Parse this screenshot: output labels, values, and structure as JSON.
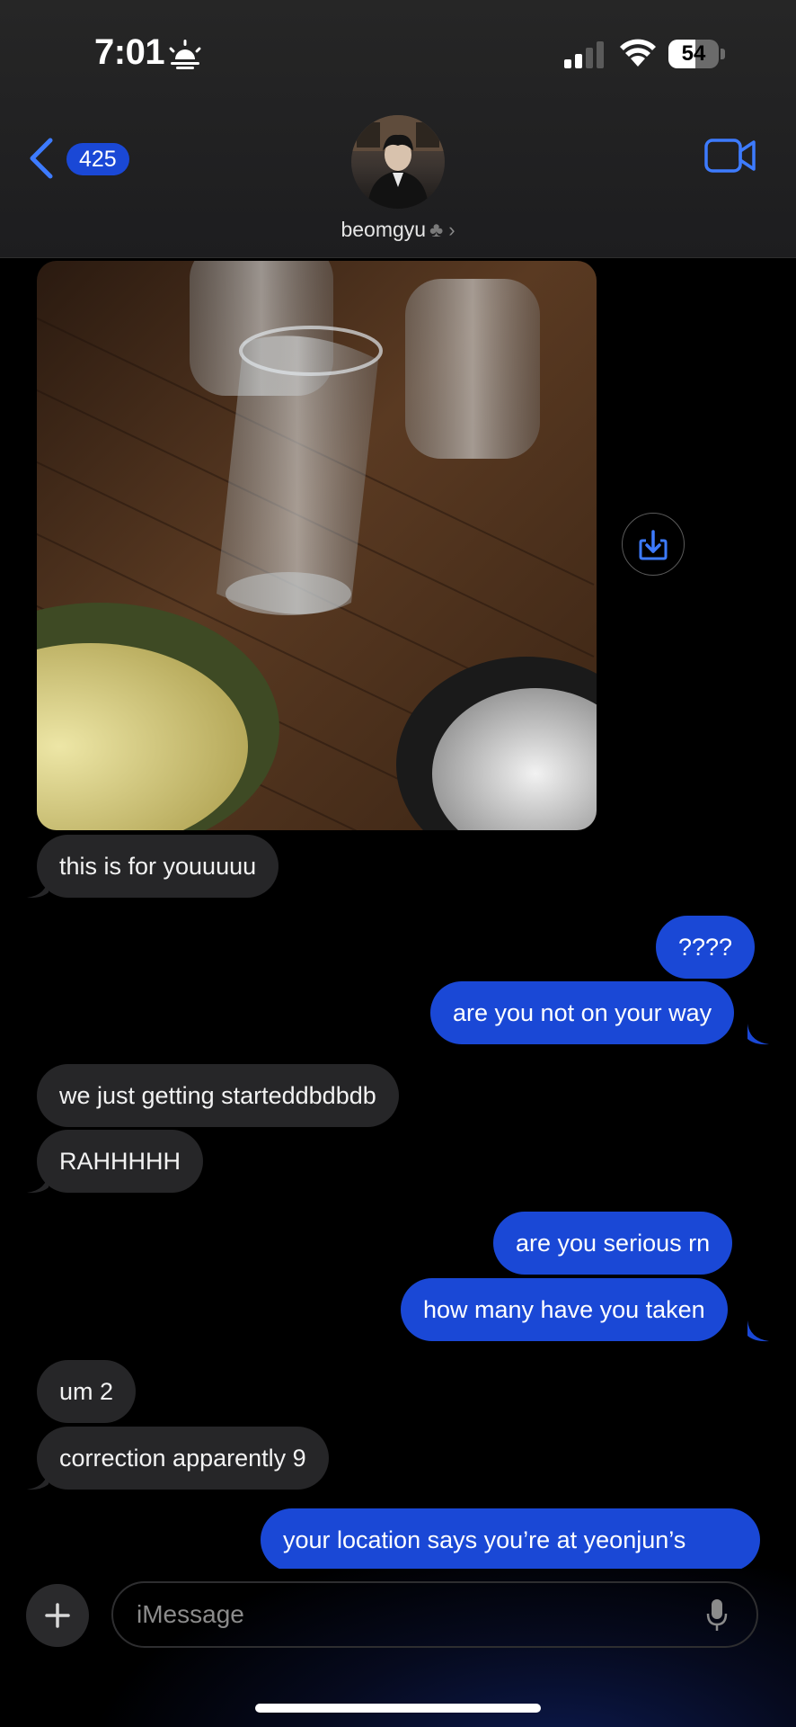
{
  "status_bar": {
    "time": "7:01",
    "time_icon": "sunrise-icon",
    "battery_percent": 54,
    "battery_label": "54"
  },
  "header": {
    "back_badge": "425",
    "contact_name": "beomgyu",
    "contact_emoji": "♣",
    "accent": "#1a48d6"
  },
  "messages": [
    {
      "side": "received",
      "type": "photo",
      "description_icon": "photo-attachment"
    },
    {
      "side": "received",
      "text": "this is for youuuuu"
    },
    {
      "side": "sent",
      "text": "????"
    },
    {
      "side": "sent",
      "text": "are you not on your way"
    },
    {
      "side": "received",
      "text": "we just getting starteddbdbdb"
    },
    {
      "side": "received",
      "text": "RAHHHHH"
    },
    {
      "side": "sent",
      "text": "are you serious rn"
    },
    {
      "side": "sent",
      "text": "how many have you taken"
    },
    {
      "side": "received",
      "text": "um 2"
    },
    {
      "side": "received",
      "text": "correction apparently 9"
    },
    {
      "side": "sent",
      "text": "your location says you’re at yeonjun’s"
    }
  ],
  "compose": {
    "placeholder": "iMessage"
  },
  "colors": {
    "sent_bubble": "#1a48d6",
    "received_bubble": "#262628",
    "background": "#000000"
  }
}
